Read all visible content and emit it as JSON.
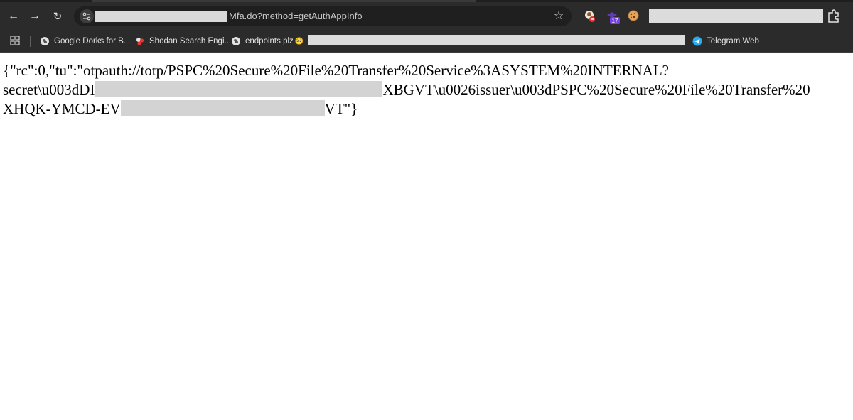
{
  "browser": {
    "nav": {
      "back_glyph": "←",
      "forward_glyph": "→",
      "reload_glyph": "↻",
      "back_icon": "arrow-left-icon",
      "forward_icon": "arrow-right-icon",
      "reload_icon": "reload-icon"
    },
    "omnibox": {
      "url_visible": "Mfa.do?method=getAuthAppInfo",
      "url_host_redacted": true,
      "bookmark_star_glyph": "☆"
    },
    "extensions": [
      {
        "name": "chef-hat-extension-icon"
      },
      {
        "name": "badge-extension-icon",
        "badge": "17"
      },
      {
        "name": "cookie-extension-icon"
      }
    ],
    "profile_redacted": true
  },
  "bookmarks": {
    "items": [
      {
        "label": "Google Dorks for B...",
        "icon": "globe-icon"
      },
      {
        "label": "Shodan Search Engi...",
        "icon": "shodan-icon"
      },
      {
        "label": "endpoints plz",
        "icon": "globe-icon",
        "emoji": "🥺"
      },
      {
        "label": "Telegram Web",
        "icon": "telegram-icon"
      }
    ]
  },
  "page": {
    "line1": "{\"rc\":0,\"tu\":\"otpauth://totp/PSPC%20Secure%20File%20Transfer%20Service%3ASYSTEM%20INTERNAL?",
    "line2_start": "secret\\u003dDI",
    "line2_end": "XBGVT\\u0026issuer\\u003dPSPC%20Secure%20File%20Transfer%20",
    "line3_start": "XHQK-YMCD-EV",
    "line3_end": "VT\"}"
  },
  "colors": {
    "chrome_bg": "#2b2b2b",
    "omnibox_bg": "#1f1f1f",
    "redaction": "#d3d3d3",
    "badge_purple": "#7b3fe4",
    "telegram_blue": "#2aabee"
  }
}
